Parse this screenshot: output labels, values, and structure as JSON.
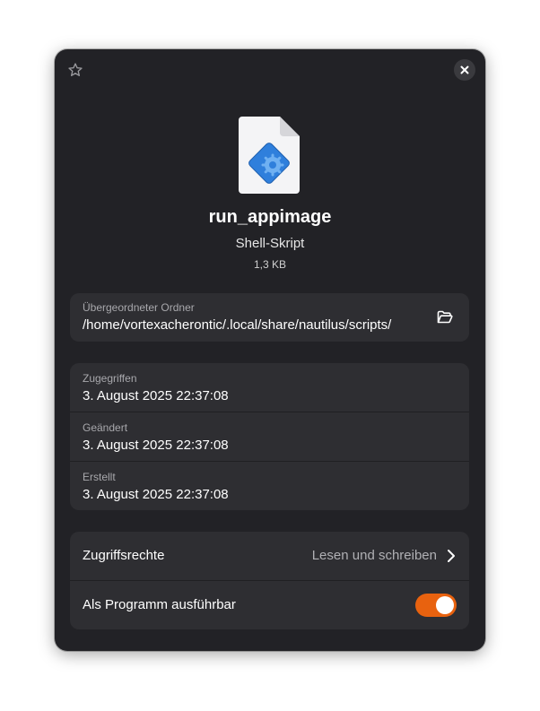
{
  "file": {
    "name": "run_appimage",
    "type": "Shell-Skript",
    "size": "1,3 KB",
    "icon": "script-file-icon"
  },
  "header": {
    "star_icon": "star-icon",
    "close_icon": "close-icon"
  },
  "parent_folder": {
    "label": "Übergeordneter Ordner",
    "path": "/home/vortexacherontic/.local/share/nautilus/scripts/",
    "open_icon": "folder-open-icon"
  },
  "dates": [
    {
      "label": "Zugegriffen",
      "value": "3. August 2025 22:37:08"
    },
    {
      "label": "Geändert",
      "value": "3. August 2025 22:37:08"
    },
    {
      "label": "Erstellt",
      "value": "3. August 2025 22:37:08"
    }
  ],
  "permissions": {
    "title": "Zugriffsrechte",
    "value": "Lesen und schreiben",
    "executable_label": "Als Programm ausführbar",
    "executable_enabled": true
  },
  "colors": {
    "dialog_bg": "#222226",
    "card_bg": "#2e2e32",
    "accent": "#e8620f",
    "icon_blue": "#2f7fdc"
  }
}
